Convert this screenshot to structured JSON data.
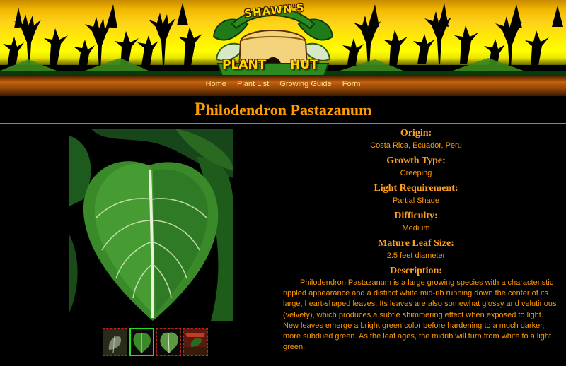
{
  "logo": {
    "brand": "SHAWN'S",
    "word1": "PLANT",
    "word2": "HUT"
  },
  "nav": {
    "items": [
      "Home",
      "Plant List",
      "Growing Guide",
      "Form"
    ]
  },
  "plant": {
    "name": "Philodendron Pastazanum"
  },
  "details": {
    "origin": {
      "label": "Origin:",
      "value": "Costa Rica, Ecuador, Peru"
    },
    "growth": {
      "label": "Growth Type:",
      "value": "Creeping"
    },
    "light": {
      "label": "Light Requirement:",
      "value": "Partial Shade"
    },
    "difficulty": {
      "label": "Difficulty:",
      "value": "Medium"
    },
    "leaf": {
      "label": "Mature Leaf Size:",
      "value": "2.5 feet diameter"
    },
    "description": {
      "label": "Description:",
      "text": "Philodendron Pastazanum is a large growing species with a characteristic rippled appearance and a distinct white mid-rib running down the center of its large, heart-shaped leaves. Its leaves are also somewhat glossy and velutinous (velvety), which produces a subtle shimmering effect when exposed to light. New leaves emerge a bright green color before hardening to a much darker, more subdued green. As the leaf ages, the midrib will turn from white to a light green."
    }
  },
  "colors": {
    "accent": "#ff9a00",
    "nav": "#ffe08a",
    "thumb_active": "#22dd22",
    "thumb_border": "#cc2222"
  },
  "icons": {
    "thumbs": [
      "plant-thumb-1",
      "plant-thumb-2",
      "plant-thumb-3",
      "plant-thumb-4"
    ]
  }
}
